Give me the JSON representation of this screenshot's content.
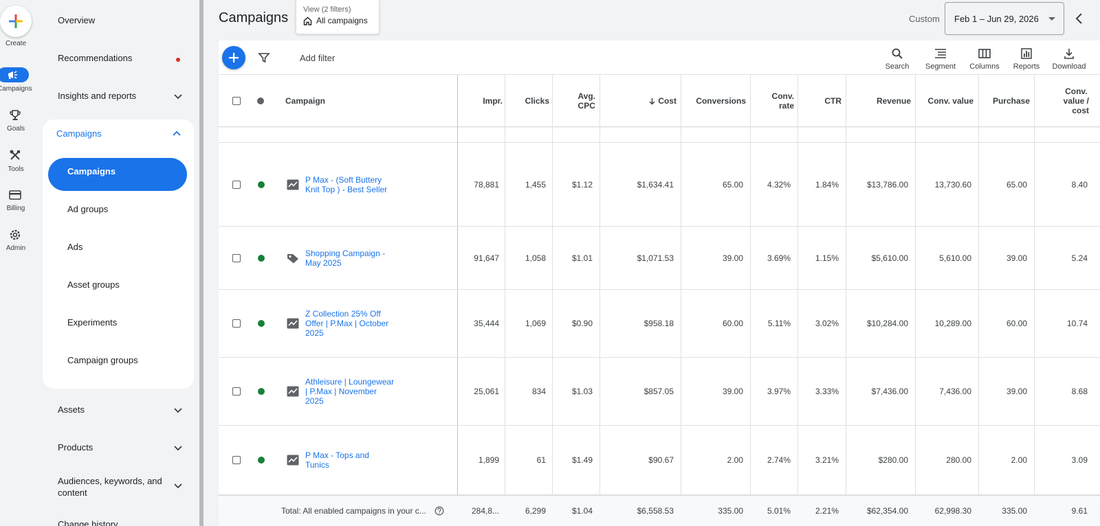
{
  "rail": {
    "create": "Create",
    "campaigns": "Campaigns",
    "goals": "Goals",
    "tools": "Tools",
    "billing": "Billing",
    "admin": "Admin"
  },
  "nav": {
    "overview": "Overview",
    "recommendations": "Recommendations",
    "insights": "Insights and reports",
    "campaigns_group": "Campaigns",
    "sub": [
      "Campaigns",
      "Ad groups",
      "Ads",
      "Asset groups",
      "Experiments",
      "Campaign groups"
    ],
    "assets": "Assets",
    "products": "Products",
    "audiences": "Audiences, keywords, and content",
    "change_history": "Change history"
  },
  "header": {
    "title": "Campaigns",
    "view_sub": "View (2 filters)",
    "view_main": "All campaigns",
    "custom": "Custom",
    "date_range": "Feb 1 – Jun 29, 2026"
  },
  "toolbar": {
    "add_filter": "Add filter",
    "search": "Search",
    "segment": "Segment",
    "columns": "Columns",
    "reports": "Reports",
    "download": "Download"
  },
  "columns": {
    "campaign": "Campaign",
    "impr": "Impr.",
    "clicks": "Clicks",
    "avg_cpc_1": "Avg.",
    "avg_cpc_2": "CPC",
    "cost": "Cost",
    "conversions": "Conversions",
    "conv_rate_1": "Conv.",
    "conv_rate_2": "rate",
    "ctr": "CTR",
    "revenue": "Revenue",
    "conv_value": "Conv. value",
    "purchase": "Purchase",
    "cvc_1": "Conv.",
    "cvc_2": "value /",
    "cvc_3": "cost"
  },
  "rows": [
    {
      "name": "P Max - (Soft Buttery Knit Top ) - Best Seller",
      "impr": "78,881",
      "clicks": "1,455",
      "cpc": "$1.12",
      "cost": "$1,634.41",
      "conv": "65.00",
      "rate": "4.32%",
      "ctr": "1.84%",
      "revenue": "$13,786.00",
      "value": "13,730.60",
      "purchase": "65.00",
      "vpc": "8.40"
    },
    {
      "name": "Shopping Campaign - May 2025",
      "impr": "91,647",
      "clicks": "1,058",
      "cpc": "$1.01",
      "cost": "$1,071.53",
      "conv": "39.00",
      "rate": "3.69%",
      "ctr": "1.15%",
      "revenue": "$5,610.00",
      "value": "5,610.00",
      "purchase": "39.00",
      "vpc": "5.24"
    },
    {
      "name": "Z Collection 25% Off Offer | P.Max | October 2025",
      "impr": "35,444",
      "clicks": "1,069",
      "cpc": "$0.90",
      "cost": "$958.18",
      "conv": "60.00",
      "rate": "5.11%",
      "ctr": "3.02%",
      "revenue": "$10,284.00",
      "value": "10,289.00",
      "purchase": "60.00",
      "vpc": "10.74"
    },
    {
      "name": "Athleisure | Loungewear | P.Max | November 2025",
      "impr": "25,061",
      "clicks": "834",
      "cpc": "$1.03",
      "cost": "$857.05",
      "conv": "39.00",
      "rate": "3.97%",
      "ctr": "3.33%",
      "revenue": "$7,436.00",
      "value": "7,436.00",
      "purchase": "39.00",
      "vpc": "8.68"
    },
    {
      "name": "P Max -  Tops and Tunics",
      "impr": "1,899",
      "clicks": "61",
      "cpc": "$1.49",
      "cost": "$90.67",
      "conv": "2.00",
      "rate": "2.74%",
      "ctr": "3.21%",
      "revenue": "$280.00",
      "value": "280.00",
      "purchase": "2.00",
      "vpc": "3.09"
    }
  ],
  "total": {
    "label": "Total: All enabled campaigns in your c...",
    "impr": "284,8...",
    "clicks": "6,299",
    "cpc": "$1.04",
    "cost": "$6,558.53",
    "conv": "335.00",
    "rate": "5.01%",
    "ctr": "2.21%",
    "revenue": "$62,354.00",
    "value": "62,998.30",
    "purchase": "335.00",
    "vpc": "9.61"
  },
  "colors": {
    "accent": "#1a73e8",
    "status_green": "#188038",
    "alert_red": "#d93025"
  }
}
